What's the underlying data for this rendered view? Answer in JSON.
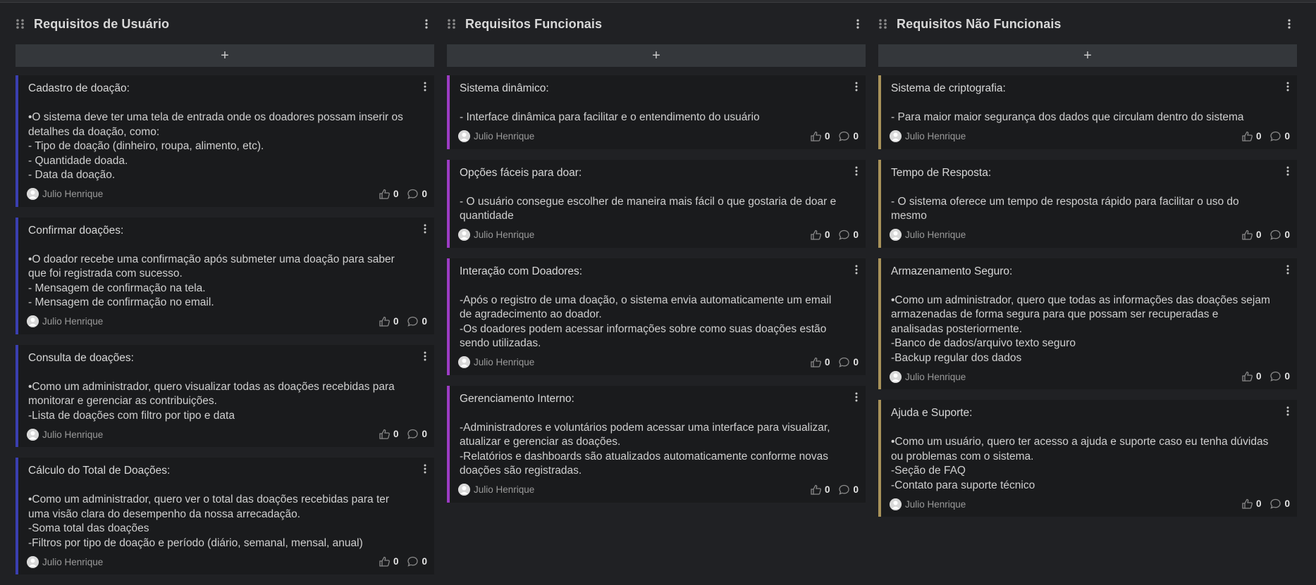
{
  "columns": [
    {
      "title": "Requisitos de Usuário",
      "accent": "#3a3fb0",
      "add_label": "+",
      "cards": [
        {
          "title": "Cadastro de doação:",
          "body": "•O sistema deve ter uma tela de entrada onde os doadores possam inserir os detalhes da doação, como:\n- Tipo de doação (dinheiro, roupa, alimento, etc).\n- Quantidade doada.\n- Data da doação.",
          "author": "Julio Henrique",
          "likes": "0",
          "comments": "0"
        },
        {
          "title": "Confirmar doações:",
          "body": "•O doador recebe uma confirmação após submeter uma doação para saber que foi registrada com sucesso.\n- Mensagem de confirmação na tela.\n- Mensagem de confirmação no email.",
          "author": "Julio Henrique",
          "likes": "0",
          "comments": "0"
        },
        {
          "title": "Consulta de doações:",
          "body": "•Como um administrador, quero visualizar todas as doações recebidas para monitorar e gerenciar as contribuições.\n-Lista de doações com filtro por tipo e data",
          "author": "Julio Henrique",
          "likes": "0",
          "comments": "0"
        },
        {
          "title": "Cálculo do Total de Doações:",
          "body": "•Como um administrador, quero ver o total das doações recebidas para ter uma visão clara do desempenho da nossa arrecadação.\n-Soma total das doações\n-Filtros por tipo de doação e período (diário, semanal, mensal, anual)",
          "author": "Julio Henrique",
          "likes": "0",
          "comments": "0"
        }
      ]
    },
    {
      "title": "Requisitos Funcionais",
      "accent": "#9c3cc4",
      "add_label": "+",
      "cards": [
        {
          "title": "Sistema dinâmico:",
          "body": "- Interface dinâmica para facilitar e o entendimento do usuário",
          "author": "Julio Henrique",
          "likes": "0",
          "comments": "0"
        },
        {
          "title": "Opções fáceis para doar:",
          "body": "- O usuário consegue escolher de maneira mais fácil o que gostaria de doar e quantidade",
          "author": "Julio Henrique",
          "likes": "0",
          "comments": "0"
        },
        {
          "title": "Interação com Doadores:",
          "body": "-Após o registro de uma doação, o sistema envia automaticamente um email de agradecimento ao doador.\n-Os doadores podem acessar informações sobre como suas doações estão sendo utilizadas.",
          "author": "Julio Henrique",
          "likes": "0",
          "comments": "0"
        },
        {
          "title": "Gerenciamento Interno:",
          "body": "-Administradores e voluntários podem acessar uma interface para visualizar, atualizar e gerenciar as doações.\n-Relatórios e dashboards são atualizados automaticamente conforme novas doações são registradas.",
          "author": "Julio Henrique",
          "likes": "0",
          "comments": "0"
        }
      ]
    },
    {
      "title": "Requisitos Não Funcionais",
      "accent": "#a8925a",
      "add_label": "+",
      "cards": [
        {
          "title": "Sistema de criptografia:",
          "body": "- Para maior maior segurança dos dados que circulam dentro do sistema",
          "author": "Julio Henrique",
          "likes": "0",
          "comments": "0"
        },
        {
          "title": "Tempo de Resposta:",
          "body": "- O sistema oferece um tempo de resposta rápido para facilitar o uso do mesmo",
          "author": "Julio Henrique",
          "likes": "0",
          "comments": "0"
        },
        {
          "title": "Armazenamento Seguro:",
          "body": "•Como um administrador, quero que todas as informações das doações sejam armazenadas de forma segura para que possam ser recuperadas e analisadas posteriormente.\n-Banco de dados/arquivo texto seguro\n-Backup regular dos dados",
          "author": "Julio Henrique",
          "likes": "0",
          "comments": "0"
        },
        {
          "title": "Ajuda e Suporte:",
          "body": "•Como um usuário, quero ter acesso a ajuda e suporte caso eu tenha dúvidas ou problemas com o sistema.\n-Seção de FAQ\n-Contato para suporte técnico",
          "author": "Julio Henrique",
          "likes": "0",
          "comments": "0"
        }
      ]
    }
  ]
}
